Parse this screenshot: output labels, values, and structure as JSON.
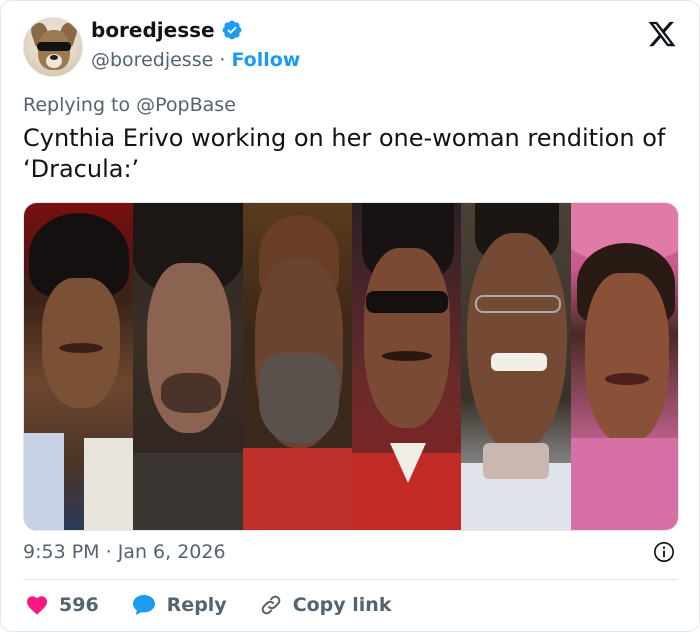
{
  "author": {
    "name": "boredjesse",
    "handle": "@boredjesse",
    "separator": "·",
    "follow_label": "Follow"
  },
  "replying_to": "Replying to @PopBase",
  "text": "Cynthia Erivo working on her one-woman rendition of ‘Dracula:’",
  "timestamp": {
    "time": "9:53 PM",
    "separator": "·",
    "date": "Jan 6, 2026"
  },
  "actions": {
    "likes": "596",
    "reply": "Reply",
    "copy_link": "Copy link"
  },
  "icons": {
    "verified": "verified-badge-icon",
    "logo": "x-logo-icon",
    "info": "info-icon",
    "heart": "heart-icon",
    "reply": "speech-bubble-icon",
    "link": "link-icon"
  },
  "colors": {
    "accent": "#1d9bf0",
    "heart": "#f91880",
    "muted": "#536471",
    "text": "#0f1419"
  },
  "media": {
    "description_panels": 6
  }
}
